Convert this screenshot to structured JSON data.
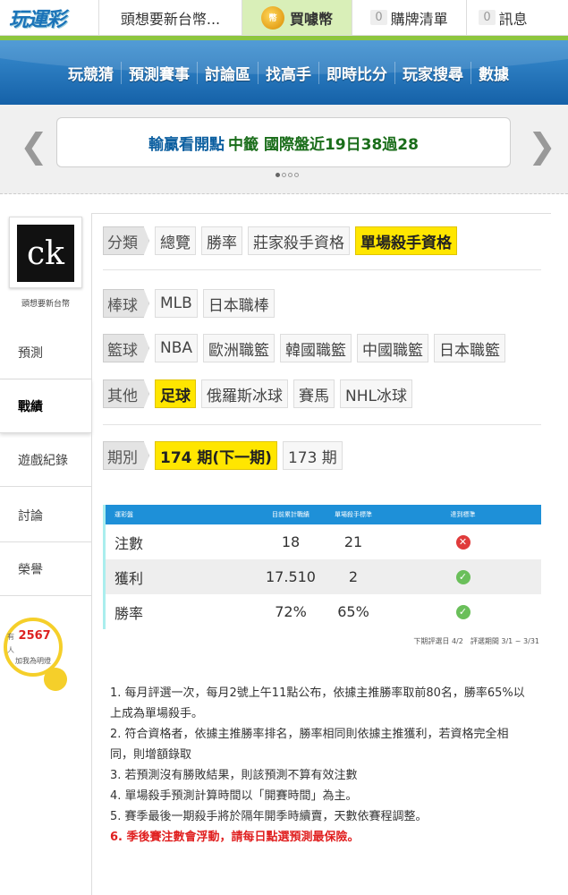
{
  "header": {
    "logo": "玩運彩",
    "user_name": "頭想要新台幣...",
    "buy_coin": "買噱幣",
    "buy_list_count": "0",
    "buy_list": "購牌清單",
    "msg_count": "0",
    "msg": "訊息"
  },
  "nav": [
    "玩競猜",
    "預測賽事",
    "討論區",
    "找高手",
    "即時比分",
    "玩家搜尋",
    "數據"
  ],
  "ticker": {
    "part1": "輸贏看開點",
    "part2": "中籤 國際盤近19日38過28"
  },
  "sidebar": {
    "name": "頭想要新台幣",
    "items": [
      "預測",
      "戰績",
      "遊戲紀錄",
      "討論",
      "榮譽"
    ],
    "active_index": 1,
    "fans_prefix": "有",
    "fans_count": "2567",
    "fans_unit": "人",
    "fans_action": "加我為明燈"
  },
  "filters": {
    "category": {
      "label": "分類",
      "options": [
        "總覽",
        "勝率",
        "莊家殺手資格",
        "單場殺手資格"
      ],
      "selected": "單場殺手資格"
    },
    "baseball": {
      "label": "棒球",
      "options": [
        "MLB",
        "日本職棒"
      ]
    },
    "basketball": {
      "label": "籃球",
      "options": [
        "NBA",
        "歐洲職籃",
        "韓國職籃",
        "中國職籃",
        "日本職籃"
      ]
    },
    "other": {
      "label": "其他",
      "options": [
        "足球",
        "俄羅斯冰球",
        "賽馬",
        "NHL冰球"
      ],
      "selected": "足球"
    },
    "period": {
      "label": "期別",
      "options": [
        "174 期(下一期)",
        "173 期"
      ],
      "selected": "174 期(下一期)"
    }
  },
  "table": {
    "headers": [
      "運彩盤",
      "目前累計戰績",
      "單場殺手標準",
      "達到標準"
    ],
    "rows": [
      {
        "label": "注數",
        "current": "18",
        "standard": "21",
        "met": "no"
      },
      {
        "label": "獲利",
        "current": "17.510",
        "standard": "2",
        "met": "yes"
      },
      {
        "label": "勝率",
        "current": "72%",
        "standard": "65%",
        "met": "yes"
      }
    ],
    "meta": "下期評選日 4/2　評選期間 3/1 ~ 3/31"
  },
  "rules": [
    "1. 每月評選一次，每月2號上午11點公布，依據主推勝率取前80名，勝率65%以上成為單場殺手。",
    "2. 符合資格者，依據主推勝率排名，勝率相同則依據主推獲利，若資格完全相同，則增額錄取",
    "3. 若預測沒有勝敗結果，則該預測不算有效注數",
    "4. 單場殺手預測計算時間以「開賽時間」為主。",
    "5. 賽季最後一期殺手將於隔年開季時續賣，天數依賽程調整。",
    "6. 季後賽注數會浮動，請每日點選預測最保險。"
  ],
  "colors": {
    "accent_green": "#8dc63f",
    "nav_blue": "#1e7fc8",
    "highlight_yellow": "#ffe600",
    "warning_red": "#e02020"
  }
}
